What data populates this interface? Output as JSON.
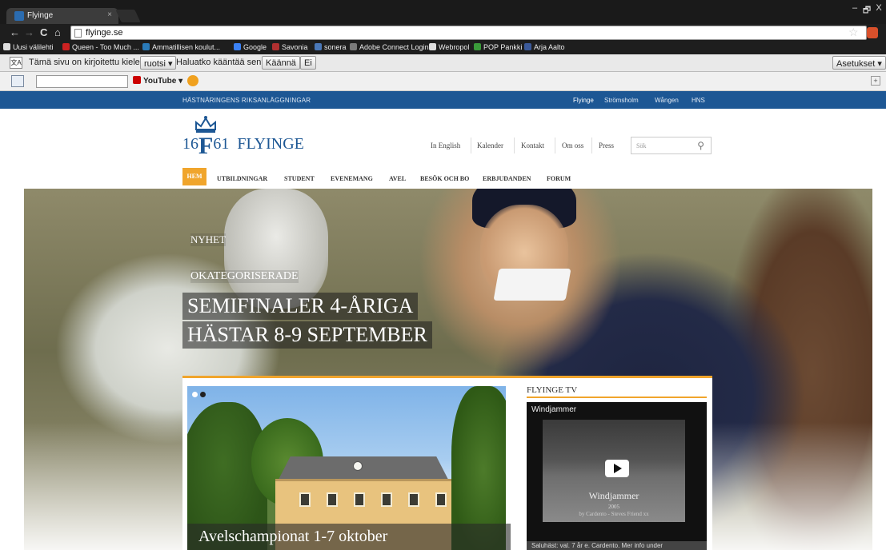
{
  "browser": {
    "tab_title": "Flyinge",
    "tab_close": "×",
    "url": "flyinge.se",
    "window_controls": [
      "–",
      "🗗",
      "X"
    ],
    "bookmarks": [
      {
        "label": "Uusi välilehti",
        "color": "#dddddd"
      },
      {
        "label": "Queen - Too Much ...",
        "color": "#cc2222"
      },
      {
        "label": "Ammatillisen koulut...",
        "color": "#2a7ab8"
      },
      {
        "label": "Google",
        "color": "#3b82f6"
      },
      {
        "label": "Savonia",
        "color": "#b03030"
      },
      {
        "label": "sonera",
        "color": "#4a78b8"
      },
      {
        "label": "Adobe Connect Login",
        "color": "#7a7a7a"
      },
      {
        "label": "Webropol",
        "color": "#dddddd"
      },
      {
        "label": "POP Pankki",
        "color": "#3a9a3a"
      },
      {
        "label": "Arja Aalto",
        "color": "#3b5998"
      }
    ],
    "translate_bar": {
      "icon_text": "文A",
      "message": "Tämä sivu on kirjoitettu kielellä",
      "language": "ruotsi",
      "question": "Haluatko kääntää sen?",
      "translate_button": "Käännä",
      "no_button": "Ei",
      "settings_button": "Asetukset"
    },
    "search_toolbar": {
      "youtube_label": "YouTube"
    }
  },
  "site": {
    "top_strip": {
      "tagline": "HÄSTNÄRINGENS RIKSANLÄGGNINGAR",
      "links": [
        "Flyinge",
        "Strömsholm",
        "Wången",
        "HNS"
      ]
    },
    "logo": {
      "year_left": "16",
      "letter": "F",
      "year_right": "61",
      "name": "FLYINGE"
    },
    "util_nav": [
      "In English",
      "Kalender",
      "Kontakt",
      "Om oss",
      "Press"
    ],
    "search_placeholder": "Sök",
    "main_nav": [
      "HEM",
      "UTBILDNINGAR",
      "STUDENT",
      "EVENEMANG",
      "AVEL",
      "BESÖK OCH BO",
      "ERBJUDANDEN",
      "FORUM"
    ],
    "hero": {
      "category1": "NYHET",
      "category2": "OKATEGORISERADE",
      "headline_line1": "SEMIFINALER 4-ÅRIGA",
      "headline_line2": "HÄSTAR 8-9 SEPTEMBER"
    },
    "slider": {
      "caption": "Avelschampionat 1-7 oktober"
    },
    "tv": {
      "section_title": "FLYINGE TV",
      "video_title": "Windjammer",
      "video_overlay_title": "Windjammer",
      "video_overlay_year": "2005",
      "video_overlay_credit": "by Cardento - Steves Friend xx",
      "description": "Saluhäst: val. 7 år e. Cardento. Mer info under"
    }
  }
}
